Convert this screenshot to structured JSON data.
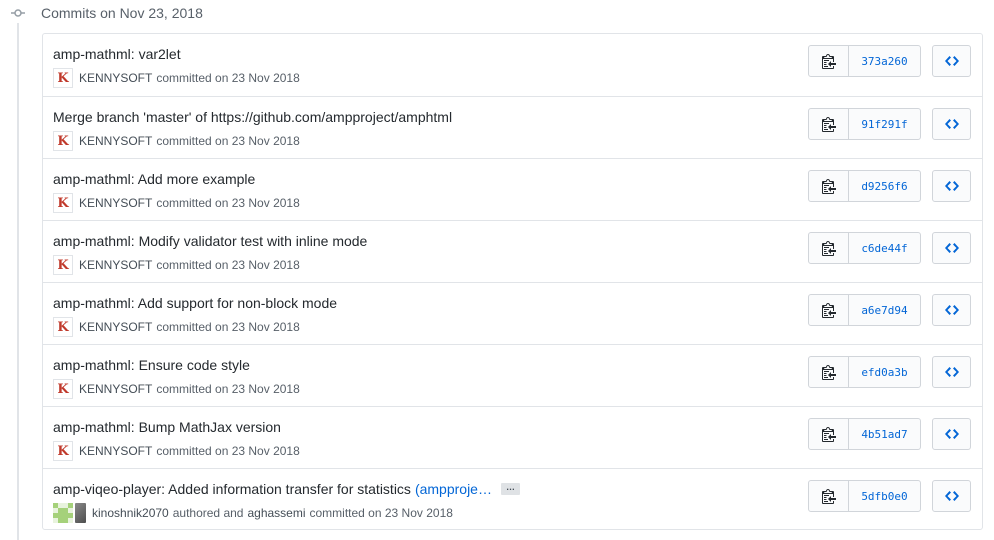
{
  "group": {
    "title": "Commits on Nov 23, 2018"
  },
  "colors": {
    "link": "#0366d6",
    "border": "#e1e4e8",
    "muted": "#586069"
  },
  "commits": [
    {
      "title": "amp-mathml: var2let",
      "author": "KENNYSOFT",
      "action": "committed on 23 Nov 2018",
      "sha": "373a260"
    },
    {
      "title": "Merge branch 'master' of https://github.com/ampproject/amphtml",
      "author": "KENNYSOFT",
      "action": "committed on 23 Nov 2018",
      "sha": "91f291f"
    },
    {
      "title": "amp-mathml: Add more example",
      "author": "KENNYSOFT",
      "action": "committed on 23 Nov 2018",
      "sha": "d9256f6"
    },
    {
      "title": "amp-mathml: Modify validator test with inline mode",
      "author": "KENNYSOFT",
      "action": "committed on 23 Nov 2018",
      "sha": "c6de44f"
    },
    {
      "title": "amp-mathml: Add support for non-block mode",
      "author": "KENNYSOFT",
      "action": "committed on 23 Nov 2018",
      "sha": "a6e7d94"
    },
    {
      "title": "amp-mathml: Ensure code style",
      "author": "KENNYSOFT",
      "action": "committed on 23 Nov 2018",
      "sha": "efd0a3b"
    },
    {
      "title": "amp-mathml: Bump MathJax version",
      "author": "KENNYSOFT",
      "action": "committed on 23 Nov 2018",
      "sha": "4b51ad7"
    }
  ],
  "last_commit": {
    "title": "amp-viqeo-player: Added information transfer for statistics",
    "issue_link": "(ampproje…",
    "ellipsis": "…",
    "author": "kinoshnik2070",
    "authored_text": "authored and",
    "committer": "aghassemi",
    "action": "committed on 23 Nov 2018",
    "sha": "5dfb0e0"
  },
  "icons": {
    "timeline": "git-commit-icon",
    "copy": "clippy-icon",
    "browse": "code-icon",
    "avatar_kennysoft": "K",
    "avatar_kinoshnik": "identicon",
    "avatar_aghassemi": "photo"
  }
}
